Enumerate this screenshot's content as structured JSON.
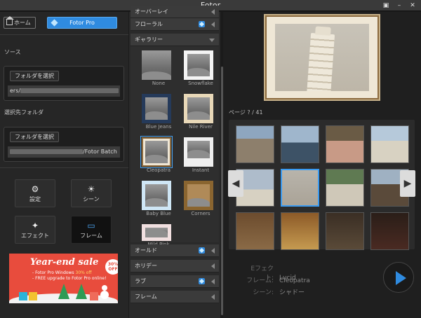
{
  "window": {
    "title": "Fotor"
  },
  "left": {
    "home_label": "ホーム",
    "pro_label": "Fotor Pro",
    "source_label": "ソース",
    "source_folder_btn": "フォルダを選択",
    "source_path": "ers/",
    "dest_label": "選択先フォルダ",
    "dest_folder_btn": "フォルダを選択",
    "dest_path": "/Fotor Batch",
    "tools": [
      {
        "label": "設定",
        "icon": "gear-icon"
      },
      {
        "label": "シーン",
        "icon": "sun-icon"
      },
      {
        "label": "エフェクト",
        "icon": "sparkle-icon"
      },
      {
        "label": "フレーム",
        "icon": "frame-icon"
      }
    ],
    "ad": {
      "title": "Year-end sale",
      "line1_prefix": "- Fotor Pro Windows ",
      "line1_highlight": "30% off",
      "line2": "- FREE upgrade to Fotor Pro online!",
      "badge": "30% OFF"
    }
  },
  "middle": {
    "top_cat": "オーバーレイ",
    "floral": "フローラル",
    "gallery": "ギャラリー",
    "frames": [
      "None",
      "Snowflake",
      "Blue Jeans",
      "Nile River",
      "Cleopatra",
      "Instant",
      "Baby Blue",
      "Corners",
      "Mild Pink"
    ],
    "bottom_cats": [
      "オールド",
      "ホリデー",
      "ラブ",
      "フレーム"
    ]
  },
  "right": {
    "page_indicator": "ページ ? / 41",
    "info": {
      "effect_label": "Eフェクト:",
      "effect_value": "Lucid",
      "frame_label": "フレーム:",
      "frame_value": "Cleopatra",
      "scene_label": "シーン:",
      "scene_value": "シャドー"
    }
  }
}
